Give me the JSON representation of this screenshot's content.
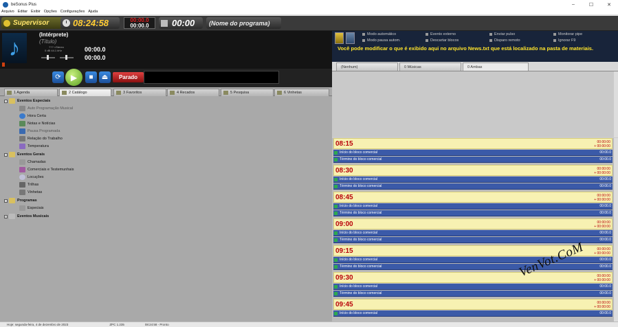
{
  "window": {
    "title": "beSonus Plus",
    "controls": [
      "–",
      "☐",
      "✕"
    ]
  },
  "menu": [
    "Arquivo",
    "Editar",
    "Exibir",
    "Opções",
    "Configurações",
    "Ajuda"
  ],
  "topbar": {
    "user": "Supervisor",
    "clock": "08:24:58",
    "counter_top": "00:00.0",
    "counter_bottom": "00:00.0",
    "program_time": "00:00",
    "program_name": "(Nome do programa)"
  },
  "player": {
    "interpreter": "(Intérprete)",
    "title": "(Título)",
    "audio_line1": "??? <Stereo",
    "audio_line2": "0 dB      44.1 kHz",
    "time1": "00:00.0",
    "time2": "00:00.0",
    "state": "Parado"
  },
  "left_tabs": [
    "1 Agenda",
    "2 Catálogo",
    "3 Favoritos",
    "4 Recados",
    "5 Pesquisa",
    "6 Vinhetas"
  ],
  "tree": {
    "eventos_especiais": "Eventos Especiais",
    "auto_prog": "Auto Programação Musical",
    "hora_certa": "Hora Certa",
    "notas": "Notas e Notícias",
    "pausa": "Pausa Programada",
    "relacao": "Relação do Trabalho",
    "temperatura": "Temperatura",
    "eventos_gerais": "Eventos Gerais",
    "chamadas": "Chamadas",
    "comerciais": "Comerciais e Testemunhais",
    "locucoes": "Locuções",
    "trilhas": "Trilhas",
    "vinhetas": "Vinhetas",
    "programas": "Programas",
    "especiais": "Especiais",
    "eventos_musicais": "Eventos Musicais"
  },
  "news": {
    "options": [
      "Modo automático",
      "Modo pausa autom.",
      "Evento externo",
      "Descartar blocos",
      "Enviar pulso",
      "Disparo remoto",
      "Monitorar pipe",
      "Ignorar F9"
    ],
    "message": "Você pode modificar o que é exibido aqui no arquivo News.txt que está localizado na pasta de materiais."
  },
  "right_tabs": [
    "(Nenhum)",
    "0 Músicas",
    "0 Ambas"
  ],
  "schedule": {
    "zero": "00:00:00",
    "plus": "+ 00:00:00",
    "block_start": "Início do bloco comercial",
    "block_end": "Término do bloco comercial",
    "block_val": "00:00.0",
    "hours": [
      "08:15",
      "08:30",
      "08:45",
      "09:00",
      "09:15",
      "09:30",
      "09:45"
    ]
  },
  "watermark": "VenVot.CoM",
  "status": {
    "date": "Hoje: segunda-feira, 4 de dezembro de 2023",
    "ver": "ZPC 1.235",
    "time": "08:24:58 - Pronto"
  },
  "colors": {
    "accent_yellow": "#ffcc33",
    "hour_red": "#b8000a",
    "block_blue": "#3b5aa8",
    "news_yellow": "#ffe42a"
  }
}
